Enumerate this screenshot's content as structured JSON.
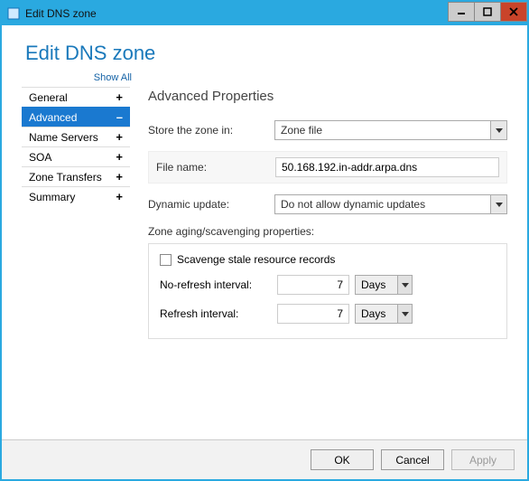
{
  "window": {
    "title": "Edit DNS zone"
  },
  "page": {
    "heading": "Edit DNS zone",
    "show_all": "Show All"
  },
  "sidebar": {
    "items": [
      {
        "label": "General",
        "indicator": "+"
      },
      {
        "label": "Advanced",
        "indicator": "–"
      },
      {
        "label": "Name Servers",
        "indicator": "+"
      },
      {
        "label": "SOA",
        "indicator": "+"
      },
      {
        "label": "Zone Transfers",
        "indicator": "+"
      },
      {
        "label": "Summary",
        "indicator": "+"
      }
    ]
  },
  "advanced": {
    "title": "Advanced Properties",
    "store_label": "Store the zone in:",
    "store_value": "Zone file",
    "filename_label": "File name:",
    "filename_value": "50.168.192.in-addr.arpa.dns",
    "dynupd_label": "Dynamic update:",
    "dynupd_value": "Do not allow dynamic updates",
    "scavenge": {
      "group_title": "Zone aging/scavenging properties:",
      "checkbox_label": "Scavenge stale resource records",
      "checked": false,
      "norefresh_label": "No-refresh interval:",
      "norefresh_value": "7",
      "norefresh_unit": "Days",
      "refresh_label": "Refresh interval:",
      "refresh_value": "7",
      "refresh_unit": "Days"
    }
  },
  "footer": {
    "ok": "OK",
    "cancel": "Cancel",
    "apply": "Apply"
  }
}
